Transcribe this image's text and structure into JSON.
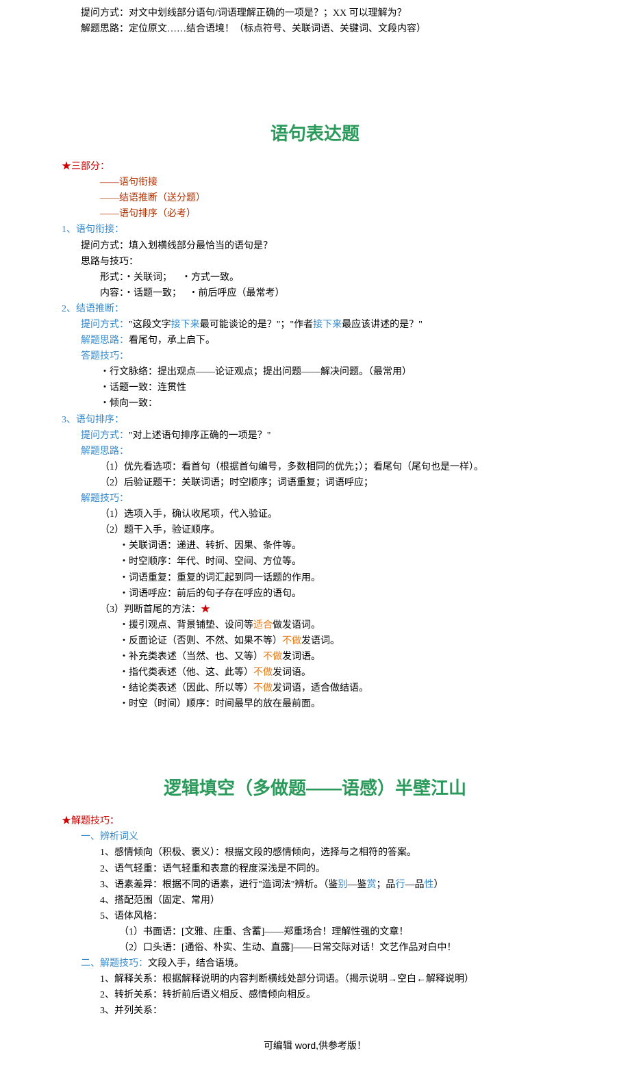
{
  "top": {
    "line1": "提问方式：对文中划线部分语句/词语理解正确的一项是？；XX 可以理解为？",
    "line2": "解题思路：定位原文……结合语境！（标点符号、关联词语、关键词、文段内容）"
  },
  "s1": {
    "title": "语句表达题",
    "star": "★三部分：",
    "p1": "——语句衔接",
    "p2": "——结语推断（送分题）",
    "p3": "——语句排序（必考）",
    "h1": "1、语句衔接：",
    "h1a": "提问方式：填入划横线部分最恰当的语句是？",
    "h1b": "思路与技巧：",
    "h1c_pre": "形式：・关联词；",
    "h1c_post": "・方式一致。",
    "h1d_pre": "内容：・话题一致；",
    "h1d_post": "・前后呼应（最常考）",
    "h2": "2、结语推断：",
    "h2a_l": "提问方式：",
    "h2a_r1": "\"这段文字",
    "h2a_r2": "接下来",
    "h2a_r3": "最可能谈论的是？\"；\"作者",
    "h2a_r4": "接下来",
    "h2a_r5": "最应该讲述的是？\"",
    "h2b_l": "解题思路：",
    "h2b_r": "看尾句，承上启下。",
    "h2c_l": "答题技巧：",
    "h2c1": "・行文脉络：提出观点——论证观点；提出问题——解决问题。（最常用）",
    "h2c2": "・话题一致：连贯性",
    "h2c3": "・倾向一致：",
    "h3": "3、语句排序：",
    "h3a_l": "提问方式：",
    "h3a_r": "\"对上述语句排序正确的一项是？\"",
    "h3b_l": "解题思路：",
    "h3b1": "（1）优先看选项：看首句（根据首句编号，多数相同的优先；）；看尾句（尾句也是一样）。",
    "h3b2": "（2）后验证题干：关联词语；时空顺序；词语重复；词语呼应；",
    "h3c_l": "解题技巧：",
    "h3c1": "（1）选项入手，确认收尾项，代入验证。",
    "h3c2": "（2）题干入手，验证顺序。",
    "h3c2a": "・关联词语：递进、转折、因果、条件等。",
    "h3c2b": "・时空顺序：年代、时间、空间、方位等。",
    "h3c2c": "・词语重复：重复的词汇起到同一话题的作用。",
    "h3c2d": "・词语呼应：前后的句子存在呼应的语句。",
    "h3c3_pre": "（3）判断首尾的方法：",
    "h3c3_star": "★",
    "h3c3a_pre": "・援引观点、背景铺垫、设问等",
    "h3c3a_mid": "适合",
    "h3c3a_post": "做发语词。",
    "h3c3b_pre": "・反面论证（否则、不然、如果不等）",
    "h3c3b_mid": "不做",
    "h3c3b_post": "发语词。",
    "h3c3c_pre": "・补充类表述（当然、也、又等）",
    "h3c3c_mid": "不做",
    "h3c3c_post": "发词语。",
    "h3c3d_pre": "・指代类表述（他、这、此等）",
    "h3c3d_mid": "不做",
    "h3c3d_post": "发词语。",
    "h3c3e_pre": "・结论类表述（因此、所以等）",
    "h3c3e_mid": "不做",
    "h3c3e_post": "发词语，适合做结语。",
    "h3c3f": "・时空（时间）顺序：时间最早的放在最前面。"
  },
  "s2": {
    "title": "逻辑填空（多做题——语感）半壁江山",
    "star": "★解题技巧：",
    "h1": "一、辨析词义",
    "h1a": "1、感情倾向（积极、褒义）：根据文段的感情倾向，选择与之相符的答案。",
    "h1b": "2、语气轻重：语气轻重和表意的程度深浅是不同的。",
    "h1c_pre": "3、语素差异：根据不同的语素，进行\"造词法\"辨析。（鉴",
    "h1c_m1": "别",
    "h1c_m2": "—鉴",
    "h1c_m3": "赏",
    "h1c_m4": "；品",
    "h1c_m5": "行",
    "h1c_m6": "—品",
    "h1c_m7": "性",
    "h1c_post": "）",
    "h1d": "4、搭配范围（固定、常用）",
    "h1e": "5、语体风格：",
    "h1e1": "（1）书面语：[文雅、庄重、含蓄]——郑重场合！理解性强的文章！",
    "h1e2": "（2）口头语：[通俗、朴实、生动、直露]——日常交际对话！文艺作品对白中！",
    "h2_l": "二、解题技巧：",
    "h2_r": "文段入手，结合语境。",
    "h2a": "1、解释关系：根据解释说明的内容判断横线处部分词语。（揭示说明→空白←解释说明）",
    "h2b": "2、转折关系：转折前后语义相反、感情倾向相反。",
    "h2c": "3、并列关系："
  },
  "footer": "可编辑 word,供参考版！"
}
